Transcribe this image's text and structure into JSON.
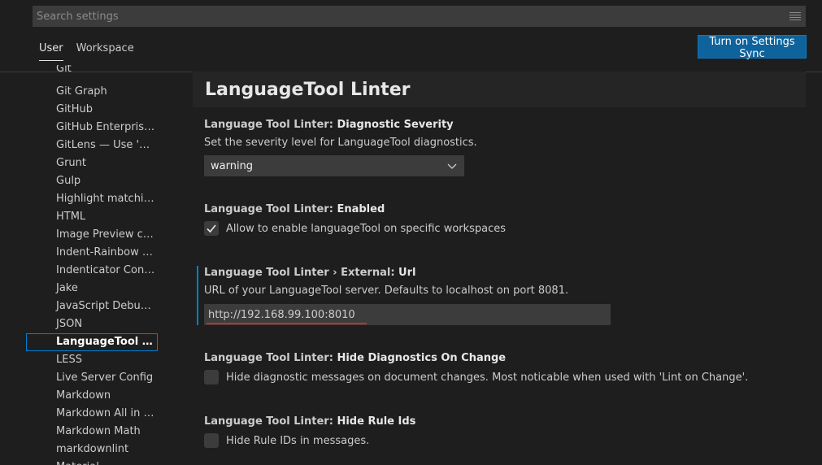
{
  "search": {
    "placeholder": "Search settings",
    "icon": "filter-icon"
  },
  "tabs": [
    {
      "label": "User",
      "active": true
    },
    {
      "label": "Workspace",
      "active": false
    }
  ],
  "sync_button": {
    "label": "Turn on Settings Sync"
  },
  "toc": {
    "items": [
      "Git",
      "Git Graph",
      "GitHub",
      "GitHub Enterprise ...",
      "GitLens — Use 'Git...",
      "Grunt",
      "Gulp",
      "Highlight matching...",
      "HTML",
      "Image Preview conf...",
      "Indent-Rainbow co...",
      "Indenticator Config...",
      "Jake",
      "JavaScript Debugger",
      "JSON",
      "LanguageTool Lin...",
      "LESS",
      "Live Server Config",
      "Markdown",
      "Markdown All in One",
      "Markdown Math",
      "markdownlint",
      "Material..."
    ],
    "selected": "LanguageTool Lin..."
  },
  "section": {
    "title": "LanguageTool Linter"
  },
  "settings": {
    "severity": {
      "category": "Language Tool Linter: ",
      "key": "Diagnostic Severity",
      "description": "Set the severity level for LanguageTool diagnostics.",
      "value": "warning"
    },
    "enabled": {
      "category": "Language Tool Linter: ",
      "key": "Enabled",
      "label": "Allow to enable languageTool on specific workspaces",
      "checked": true
    },
    "url": {
      "category": "Language Tool Linter › External: ",
      "key": "Url",
      "description": "URL of your LanguageTool server. Defaults to localhost on port 8081.",
      "value": "http://192.168.99.100:8010"
    },
    "hide_diagnostics": {
      "category": "Language Tool Linter: ",
      "key": "Hide Diagnostics On Change",
      "label": "Hide diagnostic messages on document changes. Most noticable when used with 'Lint on Change'.",
      "checked": false
    },
    "hide_rule_ids": {
      "category": "Language Tool Linter: ",
      "key": "Hide Rule Ids",
      "label": "Hide Rule IDs in messages.",
      "checked": false
    }
  },
  "colors": {
    "background": "#1e1e1e",
    "accent": "#007fd4",
    "button": "#0e639c",
    "input": "#3c3c3c",
    "spell_error": "#c72e2e"
  }
}
